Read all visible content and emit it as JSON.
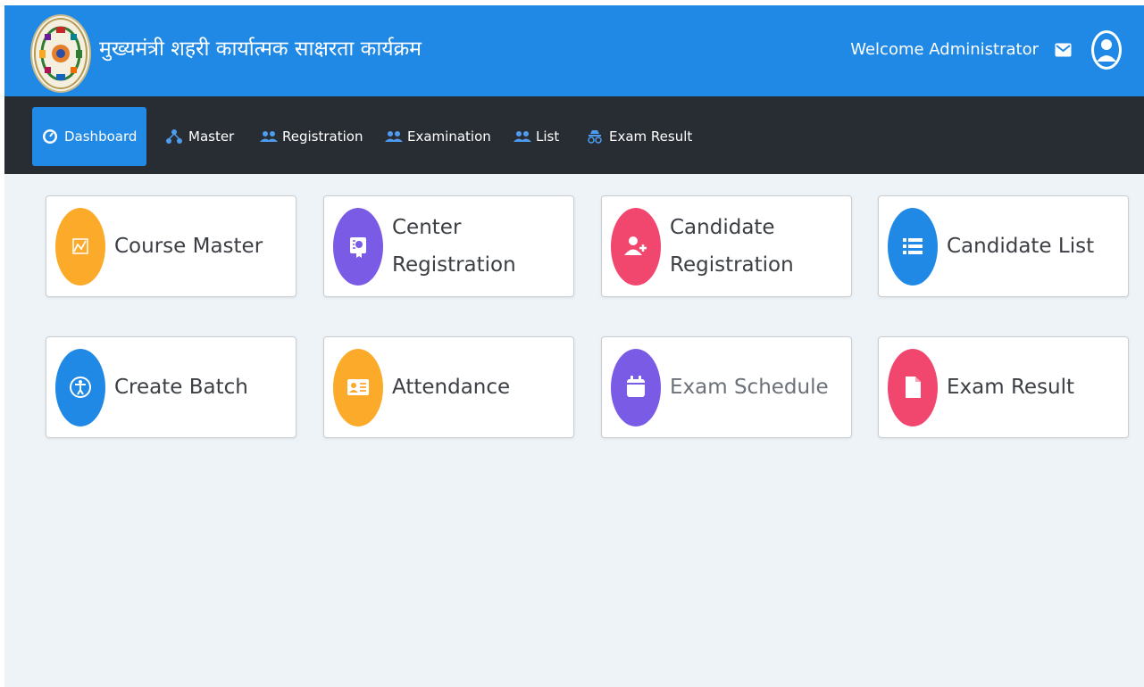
{
  "header": {
    "title": "मुख्यमंत्री शहरी कार्यात्मक साक्षरता कार्यक्रम",
    "welcome": "Welcome Administrator",
    "logo_icon": "emblem-logo-icon",
    "mail_icon": "mail-icon",
    "avatar_icon": "user-avatar-icon",
    "background_color": "#1f89e5"
  },
  "navbar": {
    "background_color": "#282d33",
    "active_color": "#2189e6",
    "items": [
      {
        "label": "Dashboard",
        "icon": "dashboard-gauge-icon",
        "active": true
      },
      {
        "label": "Master",
        "icon": "sitemap-icon",
        "active": false
      },
      {
        "label": "Registration",
        "icon": "users-icon",
        "active": false
      },
      {
        "label": "Examination",
        "icon": "users-icon",
        "active": false
      },
      {
        "label": "List",
        "icon": "users-icon",
        "active": false
      },
      {
        "label": "Exam Result",
        "icon": "user-secret-icon",
        "active": false
      }
    ]
  },
  "tiles": [
    {
      "label": "Course Master",
      "icon": "chart-line-icon",
      "color": "#fbaa2a"
    },
    {
      "label": "Center Registration",
      "icon": "certificate-icon",
      "color": "#7a5be6"
    },
    {
      "label": "Candidate Registration",
      "icon": "user-plus-icon",
      "color": "#f1466e"
    },
    {
      "label": "Candidate List",
      "icon": "list-icon",
      "color": "#1f89e5"
    },
    {
      "label": "Create Batch",
      "icon": "accessibility-icon",
      "color": "#1f89e5"
    },
    {
      "label": "Attendance",
      "icon": "id-card-icon",
      "color": "#fbaa2a"
    },
    {
      "label": "Exam Schedule",
      "icon": "calendar-icon",
      "color": "#7a5be6"
    },
    {
      "label": "Exam Result",
      "icon": "file-icon",
      "color": "#f1466e"
    }
  ]
}
